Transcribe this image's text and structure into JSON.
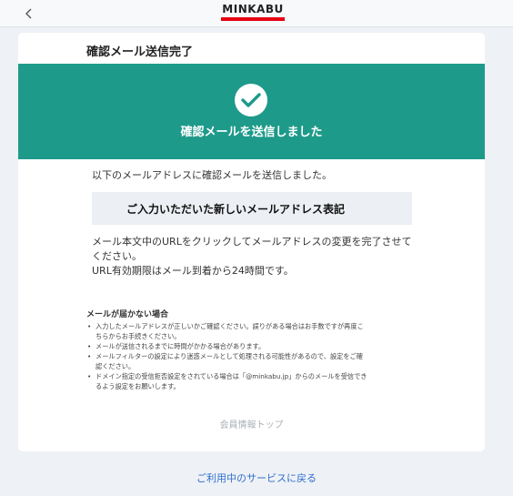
{
  "header": {
    "logo_text": "MINKABU",
    "back_icon": "chevron-left-icon",
    "brand_color": "#e60012"
  },
  "card": {
    "title": "確認メール送信完了",
    "banner": {
      "icon": "check-circle-icon",
      "message": "確認メールを送信しました",
      "color": "#1e9a8a"
    },
    "intro": "以下のメールアドレスに確認メールを送信しました。",
    "address_placeholder": "ご入力いただいた新しいメールアドレス表記",
    "instructions": [
      "メール本文中のURLをクリックしてメールアドレスの変更を完了させて",
      "ください。",
      "URL有効期限はメール到着から24時間です。"
    ],
    "help": {
      "title": "メールが届かない場合",
      "items": [
        [
          "入力したメールアドレスが正しいかご確認ください。誤りがある場合はお手数ですが再度こ",
          "ちらからお手続きください。"
        ],
        [
          "メールが送信されるまでに時間がかかる場合があります。"
        ],
        [
          "メールフィルターの設定により迷惑メールとして処理される可能性があるので、設定をご確",
          "認ください。"
        ],
        [
          "ドメイン指定の受信拒否設定をされている場合は「@minkabu.jp」からのメールを受信でき",
          "るよう設定をお願いします。"
        ]
      ]
    },
    "member_top_link": "会員情報トップ"
  },
  "footer": {
    "return_link": "ご利用中のサービスに戻る",
    "link_color": "#2f6fcf"
  }
}
